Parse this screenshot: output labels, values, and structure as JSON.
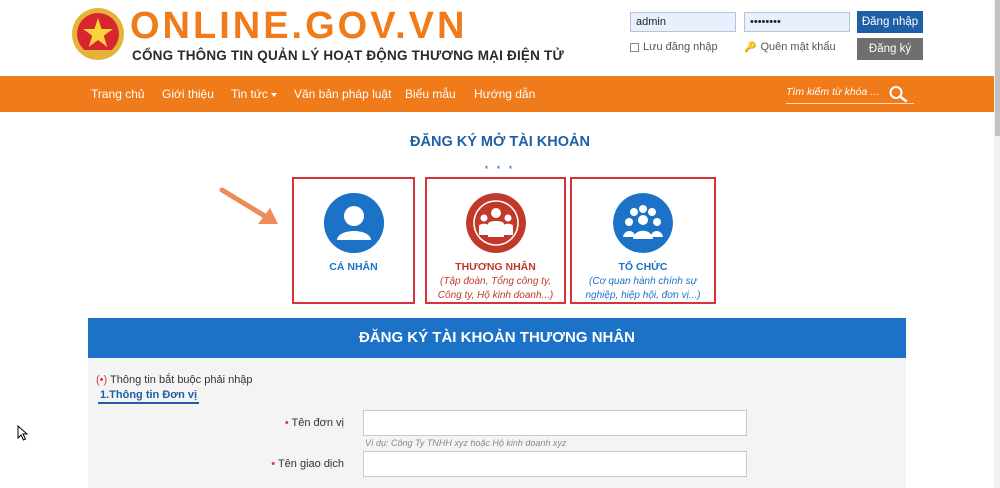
{
  "header": {
    "site_title": "ONLINE.GOV.VN",
    "site_subtitle": "CỔNG THÔNG TIN QUẢN LÝ HOẠT ĐỘNG THƯƠNG MẠI ĐIỆN TỬ",
    "emblem_icon": "national-emblem-icon"
  },
  "login": {
    "username_value": "admin",
    "password_value": "••••••••",
    "login_button": "Đăng nhập",
    "register_button": "Đăng ký",
    "remember_label": "Lưu đăng nhập",
    "forgot_label": "Quên mật khẩu"
  },
  "nav": {
    "items": [
      {
        "label": "Trang chủ"
      },
      {
        "label": "Giới thiệu"
      },
      {
        "label": "Tin tức"
      },
      {
        "label": "Văn bản pháp luật"
      },
      {
        "label": "Biểu mẫu"
      },
      {
        "label": "Hướng dẫn"
      }
    ],
    "search_placeholder": "Tìm kiếm từ khóa ..."
  },
  "registration": {
    "heading": "ĐĂNG KÝ MỞ TÀI KHOẢN",
    "stars": "* * *",
    "cards": [
      {
        "title": "CÁ NHÂN",
        "description": "",
        "icon": "person-icon",
        "color": "#1b72c6"
      },
      {
        "title": "THƯƠNG NHÂN",
        "description": "(Tập đoàn, Tổng công ty, Công ty, Hộ kinh doanh...)",
        "icon": "businessman-icon",
        "color": "#c0392b"
      },
      {
        "title": "TỔ CHỨC",
        "description": "(Cơ quan hành chính sự nghiệp, hiệp hội, đơn vị...)",
        "icon": "group-icon",
        "color": "#1b72c6"
      }
    ]
  },
  "form": {
    "header": "ĐĂNG KÝ TÀI KHOẢN THƯƠNG NHÂN",
    "required_star": "(•)",
    "required_note": "Thông tin bắt buộc phải nhập",
    "section_tab": "1.Thông tin Đơn vị",
    "fields": [
      {
        "label": "Tên đơn vị",
        "value": "",
        "hint": "Ví dụ: Công Ty TNHH xyz hoặc Hộ kinh doanh xyz"
      },
      {
        "label": "Tên giao dịch",
        "value": "",
        "hint": ""
      }
    ]
  },
  "colors": {
    "brand_orange": "#f07b1a",
    "brand_blue": "#1b72c6",
    "highlight_red": "#d7333b"
  }
}
